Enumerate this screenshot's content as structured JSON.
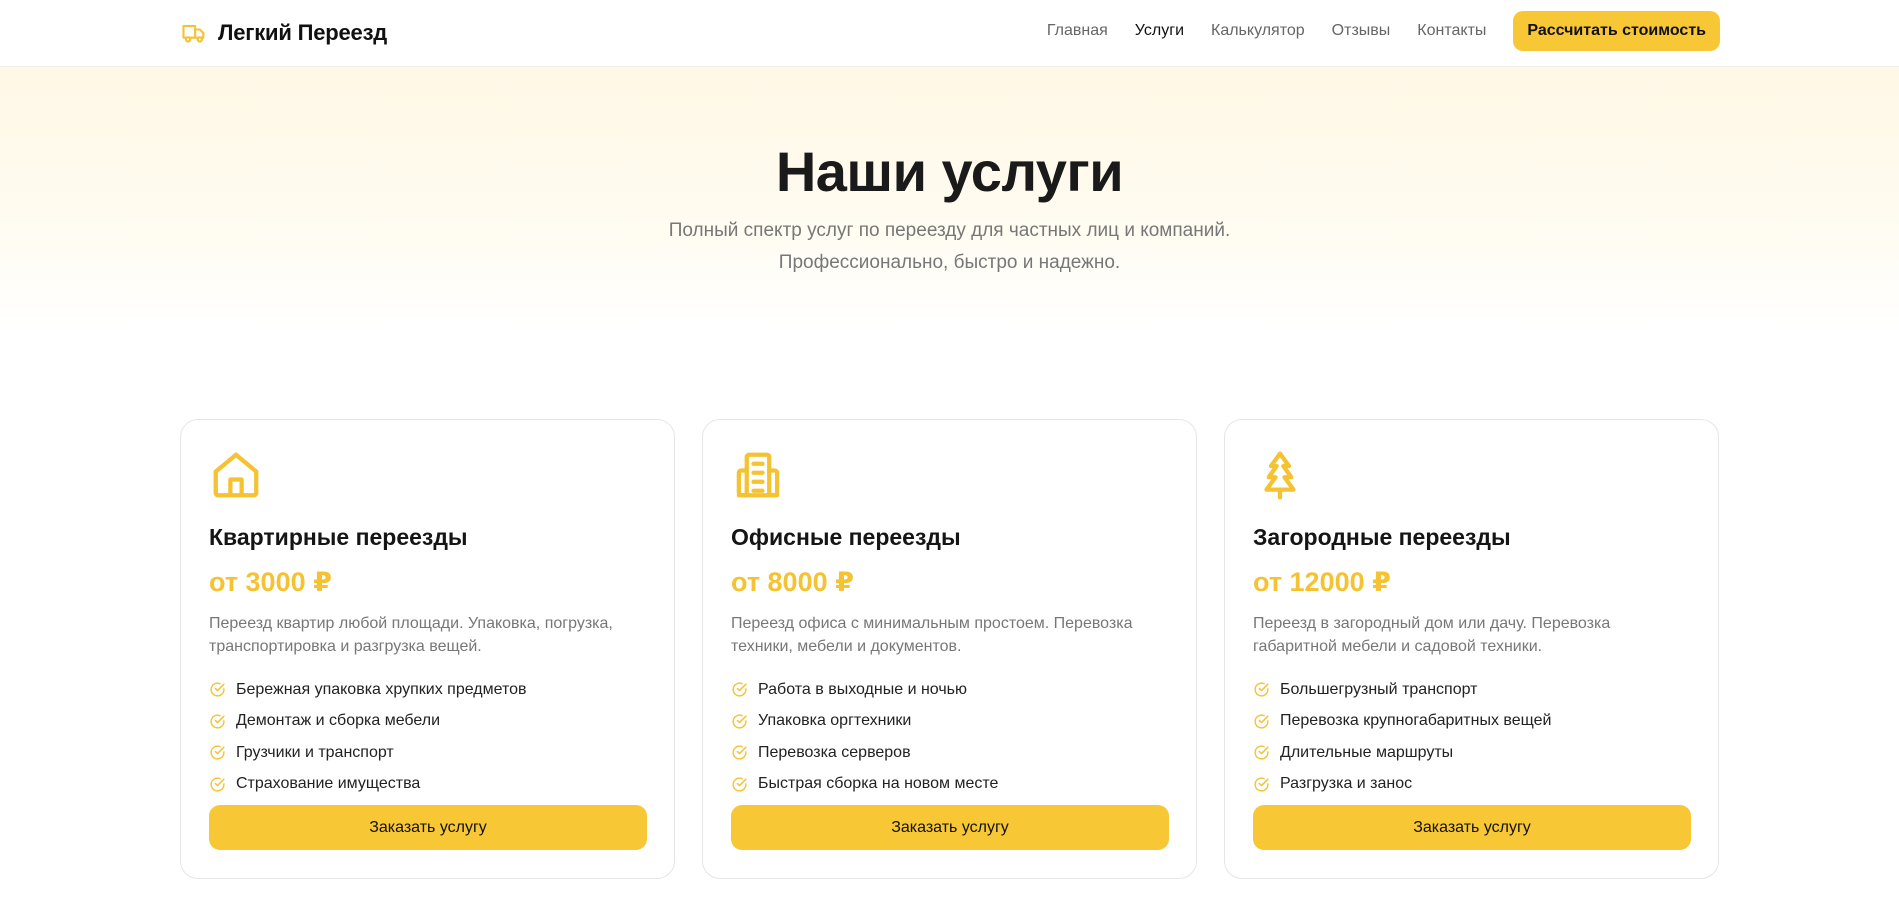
{
  "header": {
    "brand": "Легкий Переезд",
    "brand_icon": "truck-icon",
    "nav": [
      {
        "label": "Главная",
        "active": false
      },
      {
        "label": "Услуги",
        "active": true
      },
      {
        "label": "Калькулятор",
        "active": false
      },
      {
        "label": "Отзывы",
        "active": false
      },
      {
        "label": "Контакты",
        "active": false
      }
    ],
    "cta_label": "Рассчитать стоимость"
  },
  "hero": {
    "title": "Наши услуги",
    "subtitle_line1": "Полный спектр услуг по переезду для частных лиц и компаний.",
    "subtitle_line2": "Профессионально, быстро и надежно."
  },
  "colors": {
    "accent": "#f8c736",
    "price": "#f5c231",
    "text": "#1a1a1a",
    "muted": "#777777"
  },
  "services": [
    {
      "icon": "house-icon",
      "title": "Квартирные переезды",
      "price": "от 3000 ₽",
      "description": "Переезд квартир любой площади. Упаковка, погрузка, транспортировка и разгрузка вещей.",
      "features": [
        "Бережная упаковка хрупких предметов",
        "Демонтаж и сборка мебели",
        "Грузчики и транспорт",
        "Страхование имущества"
      ],
      "button": "Заказать услугу"
    },
    {
      "icon": "office-building-icon",
      "title": "Офисные переезды",
      "price": "от 8000 ₽",
      "description": "Переезд офиса с минимальным простоем. Перевозка техники, мебели и документов.",
      "features": [
        "Работа в выходные и ночью",
        "Упаковка оргтехники",
        "Перевозка серверов",
        "Быстрая сборка на новом месте"
      ],
      "button": "Заказать услугу"
    },
    {
      "icon": "tree-icon",
      "title": "Загородные переезды",
      "price": "от 12000 ₽",
      "description": "Переезд в загородный дом или дачу. Перевозка габаритной мебели и садовой техники.",
      "features": [
        "Большегрузный транспорт",
        "Перевозка крупногабаритных вещей",
        "Длительные маршруты",
        "Разгрузка и занос"
      ],
      "button": "Заказать услугу"
    }
  ]
}
